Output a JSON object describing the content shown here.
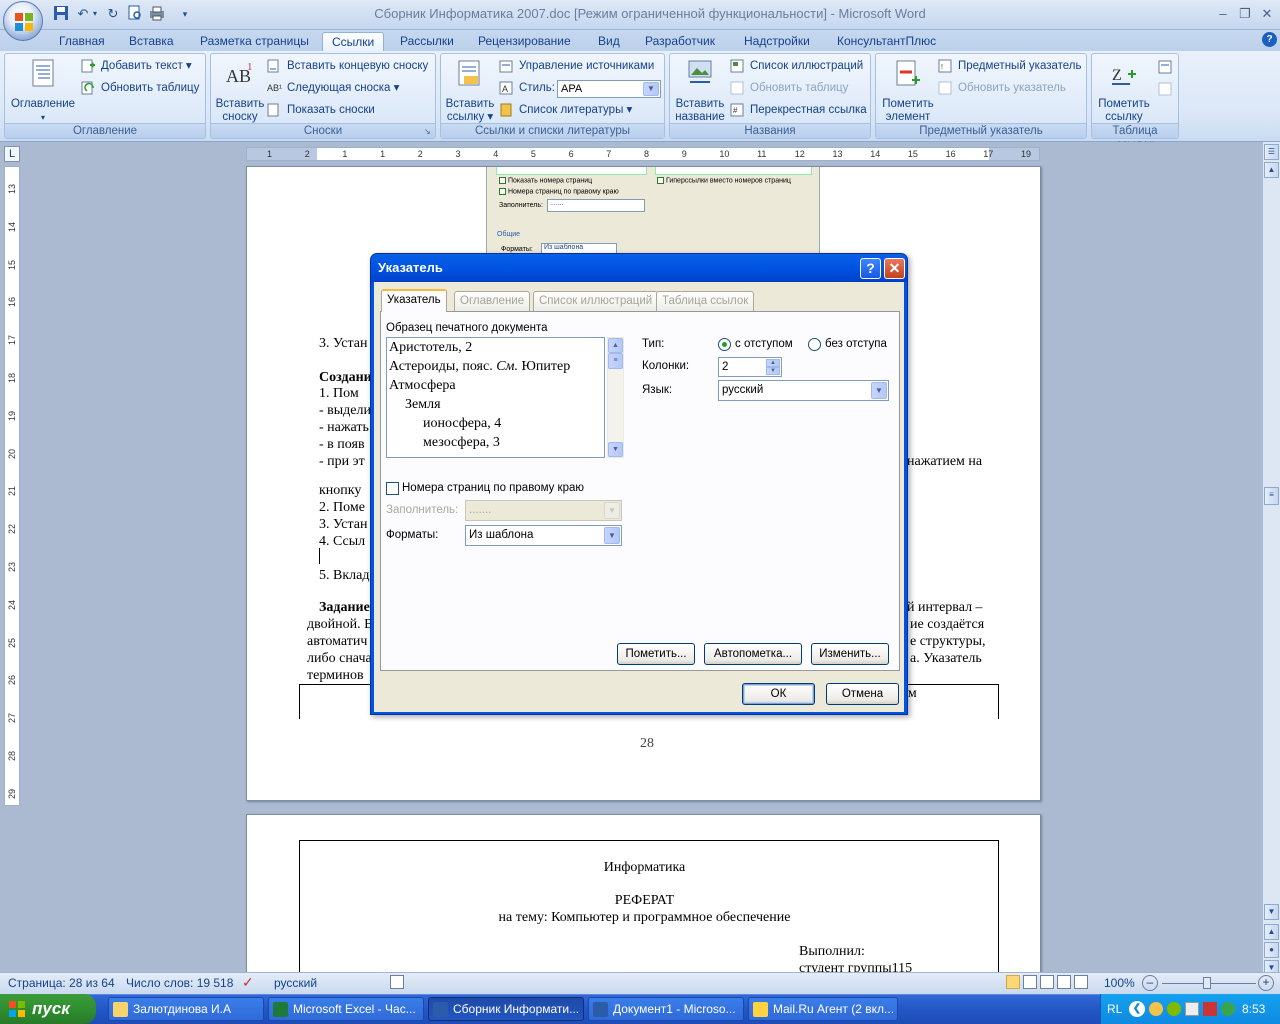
{
  "window": {
    "title": "Сборник Информатика 2007.doc [Режим ограниченной функциональности] - Microsoft Word"
  },
  "tabs": [
    "Главная",
    "Вставка",
    "Разметка страницы",
    "Ссылки",
    "Рассылки",
    "Рецензирование",
    "Вид",
    "Разработчик",
    "Надстройки",
    "КонсультантПлюс"
  ],
  "active_tab": "Ссылки",
  "ribbon": {
    "toc": {
      "label": "Оглавление",
      "big": "Оглавление",
      "add_text": "Добавить текст",
      "update_table": "Обновить таблицу"
    },
    "footnotes": {
      "label": "Сноски",
      "insert_footnote": "Вставить сноску",
      "insert_endnote": "Вставить концевую сноску",
      "next_footnote": "Следующая сноска",
      "show_notes": "Показать сноски"
    },
    "citations": {
      "label": "Ссылки и списки литературы",
      "insert_citation": "Вставить ссылку",
      "manage_sources": "Управление источниками",
      "style_label": "Стиль:",
      "style_value": "APA",
      "bibliography": "Список литературы"
    },
    "captions": {
      "label": "Названия",
      "insert_caption": "Вставить название",
      "table_of_figures": "Список иллюстраций",
      "update_table": "Обновить таблицу",
      "cross_reference": "Перекрестная ссылка"
    },
    "index": {
      "label": "Предметный указатель",
      "mark_entry": "Пометить элемент",
      "insert_index": "Предметный указатель",
      "update_index": "Обновить указатель"
    },
    "toa": {
      "label": "Таблица ссылок",
      "mark_citation": "Пометить ссылку"
    }
  },
  "ruler": {
    "h_numbers": [
      "1",
      "2",
      "1",
      "1",
      "2",
      "3",
      "4",
      "5",
      "6",
      "7",
      "8",
      "9",
      "10",
      "11",
      "12",
      "13",
      "14",
      "15",
      "16",
      "17",
      "19"
    ],
    "v_numbers": [
      "13",
      "14",
      "15",
      "16",
      "17",
      "18",
      "19",
      "20",
      "21",
      "22",
      "23",
      "24",
      "25",
      "26",
      "27",
      "28",
      "29"
    ]
  },
  "document": {
    "bg_dialog": {
      "show_page_numbers": "Показать номера страниц",
      "right_align": "Номера страниц по правому краю",
      "tab_leader": "Заполнитель:",
      "tab_leader_value": ".......",
      "hyperlinks": "Гиперссылки вместо номеров страниц",
      "general": "Общие",
      "formats": "Форматы:",
      "formats_value": "Из шаблона"
    },
    "page1_lines": [
      {
        "text": "3. Устан",
        "bold": false
      },
      {
        "text": "Создани",
        "bold": true
      },
      {
        "text": "1.   Пом",
        "bold": false
      },
      {
        "text": "- выдели",
        "bold": false
      },
      {
        "text": "- нажать",
        "bold": false
      },
      {
        "text": "- в появ",
        "bold": false
      },
      {
        "text": "- при эт",
        "bold": false
      },
      {
        "text": "кнопку",
        "bold": false
      },
      {
        "text": "2. Поме",
        "bold": false
      },
      {
        "text": "3. Устан",
        "bold": false
      },
      {
        "text": "4. Ссыл",
        "bold": false
      },
      {
        "text": "5. Вклад",
        "bold": false
      },
      {
        "text": "Задание",
        "bold": true
      },
      {
        "text": "двойной. В",
        "bold": false
      },
      {
        "text": "автоматич",
        "bold": false
      },
      {
        "text": "либо снача",
        "bold": false
      },
      {
        "text": "терминов",
        "bold": false
      }
    ],
    "page1_right_fragments": [
      "нажатием на",
      "й интервал –",
      "ие создаётся",
      "е структуры,",
      "а. Указатель",
      "ум"
    ],
    "page_number": "28",
    "page2": {
      "subject": "Информатика",
      "title": "РЕФЕРАТ",
      "topic": "на тему: Компьютер и программное обеспечение",
      "done_by": "Выполнил:",
      "student": "студент группы115"
    }
  },
  "dialog": {
    "title": "Указатель",
    "tabs": [
      "Указатель",
      "Оглавление",
      "Список иллюстраций",
      "Таблица ссылок"
    ],
    "preview_label": "Образец печатного документа",
    "preview_lines": [
      {
        "text": "Аристотель, 2",
        "indent": 0
      },
      {
        "text": "Астероиды, пояс. ",
        "italic": "См.",
        "after": " Юпитер",
        "indent": 0
      },
      {
        "text": "Атмосфера",
        "indent": 0
      },
      {
        "text": "Земля",
        "indent": 1
      },
      {
        "text": "ионосфера, 4",
        "indent": 2
      },
      {
        "text": "мезосфера, 3",
        "indent": 2
      }
    ],
    "type_label": "Тип:",
    "type_indented": "с отступом",
    "type_runin": "без отступа",
    "columns_label": "Колонки:",
    "columns_value": "2",
    "language_label": "Язык:",
    "language_value": "русский",
    "right_align_label": "Номера страниц по правому краю",
    "right_align_checked": false,
    "leader_label": "Заполнитель:",
    "leader_value": ".......",
    "formats_label": "Форматы:",
    "formats_value": "Из шаблона",
    "mark_button": "Пометить...",
    "automark_button": "Автопометка...",
    "modify_button": "Изменить...",
    "ok_button": "ОК",
    "cancel_button": "Отмена"
  },
  "statusbar": {
    "page": "Страница: 28 из 64",
    "words": "Число слов: 19 518",
    "language": "русский",
    "zoom": "100%"
  },
  "taskbar": {
    "start": "пуск",
    "tasks": [
      "Залютдинова И.А",
      "Microsoft Excel - Час...",
      "Сборник Информати...",
      "Документ1 - Microso...",
      "Mail.Ru Агент (2 вкл..."
    ],
    "active_task": 2,
    "lang": "RL",
    "time": "8:53"
  },
  "colors": {
    "accent": "#0054e3",
    "ribbon": "#dbe7f7",
    "taskbar": "#2456c6",
    "start": "#2f8f2f"
  }
}
